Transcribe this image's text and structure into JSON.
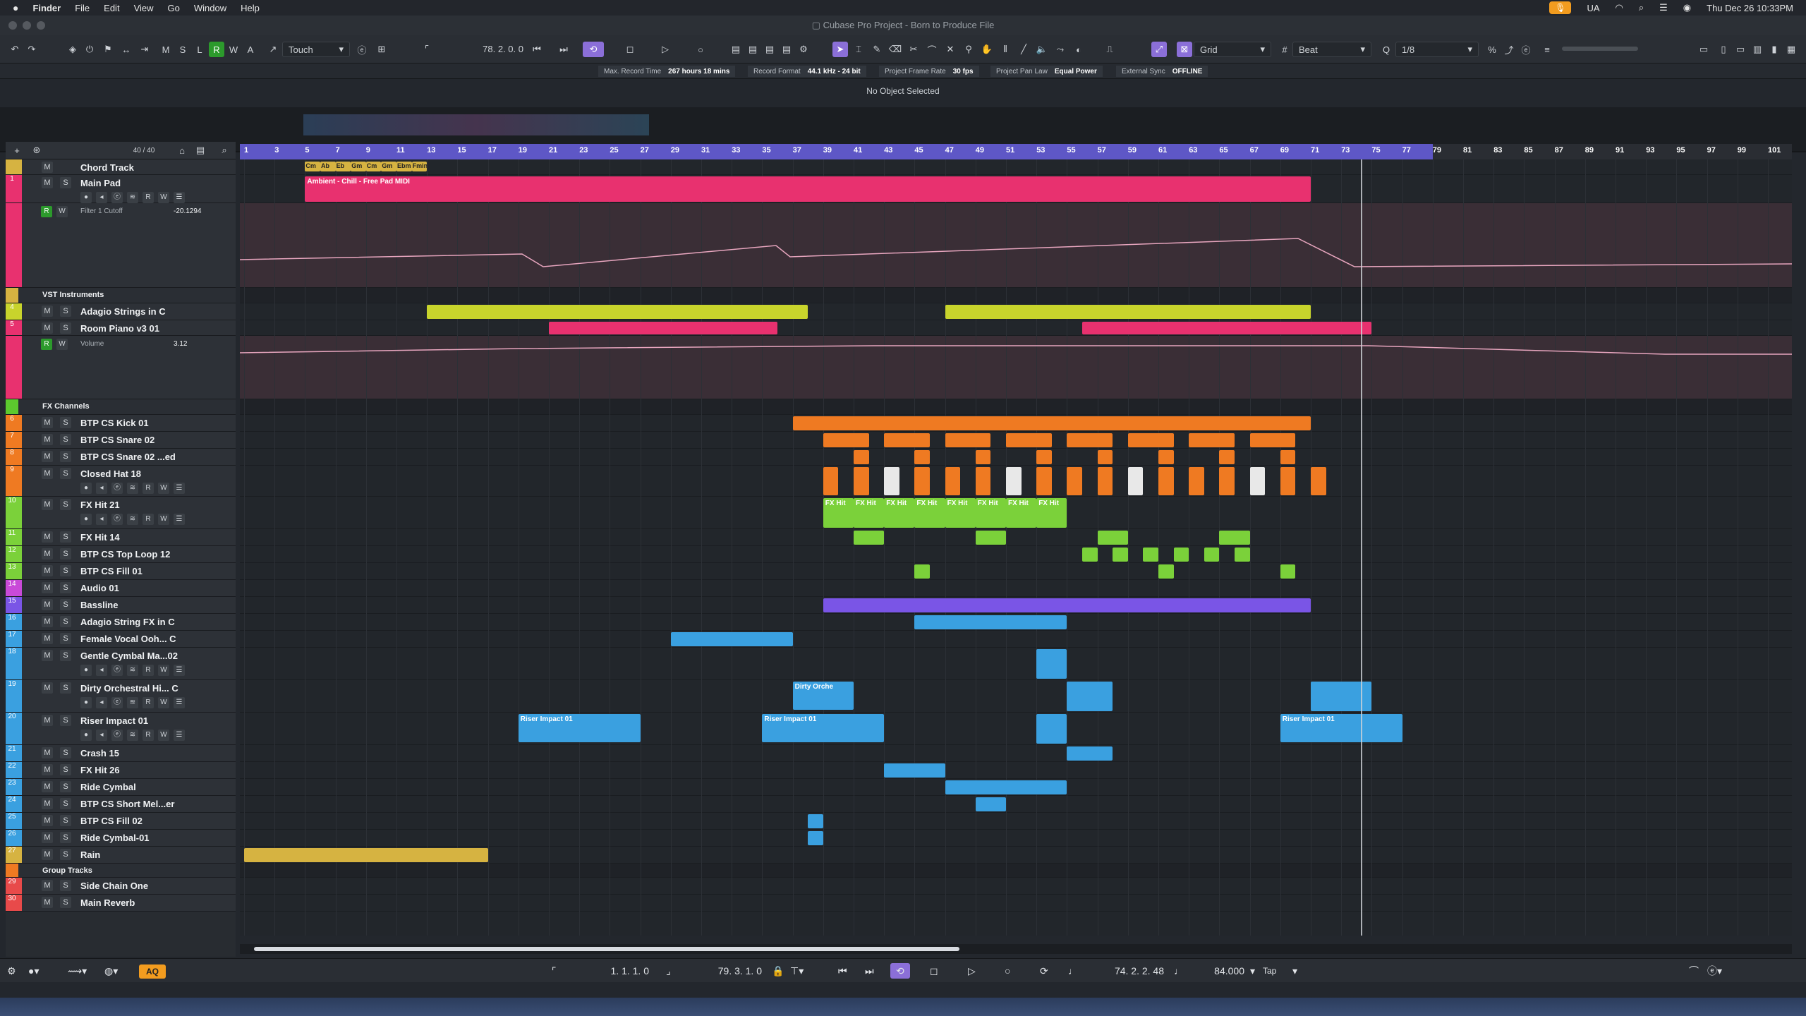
{
  "menubar": {
    "apple": "",
    "app": "Finder",
    "items": [
      "File",
      "Edit",
      "View",
      "Go",
      "Window",
      "Help"
    ],
    "lang": "UA",
    "datetime": "Thu Dec 26  10:33PM"
  },
  "window": {
    "title": "Cubase Pro Project - Born to Produce File"
  },
  "toolbar": {
    "automation_mode": "Touch",
    "position": "78. 2. 0.  0",
    "grid_type": "Grid",
    "grid_unit": "Beat",
    "quantize": "1/8"
  },
  "infoline": {
    "items": [
      {
        "label": "Max. Record Time",
        "value": "267 hours 18 mins"
      },
      {
        "label": "Record Format",
        "value": "44.1 kHz - 24 bit"
      },
      {
        "label": "Project Frame Rate",
        "value": "30 fps"
      },
      {
        "label": "Project Pan Law",
        "value": "Equal Power"
      },
      {
        "label": "External Sync",
        "value": "OFFLINE"
      }
    ]
  },
  "object_status": "No Object Selected",
  "track_header": {
    "count": "40 / 40"
  },
  "ruler": {
    "ticks": [
      "1",
      "3",
      "5",
      "7",
      "9",
      "11",
      "13",
      "15",
      "17",
      "19",
      "21",
      "23",
      "25",
      "27",
      "29",
      "31",
      "33",
      "35",
      "37",
      "39",
      "41",
      "43",
      "45",
      "47",
      "49",
      "51",
      "53",
      "55",
      "57",
      "59",
      "61",
      "63",
      "65",
      "67",
      "69",
      "71",
      "73",
      "75",
      "77",
      "79",
      "81",
      "83",
      "85",
      "87",
      "89",
      "91",
      "93",
      "95",
      "97",
      "99",
      "101"
    ]
  },
  "tracks": [
    {
      "num": "",
      "name": "Chord Track",
      "color": "#d6b341",
      "type": "chord",
      "h": 22
    },
    {
      "num": "1",
      "name": "Main Pad",
      "color": "#e8316f",
      "type": "inst",
      "h": 40
    },
    {
      "num": "",
      "name": "Filter 1 Cutoff",
      "color": "#e8316f",
      "type": "auto",
      "h": 120,
      "value": "-20.1294"
    },
    {
      "num": "",
      "name": "VST Instruments",
      "color": "#d6b341",
      "type": "folder",
      "h": 22
    },
    {
      "num": "4",
      "name": "Adagio Strings in C",
      "color": "#c8d42c",
      "type": "inst",
      "h": 24
    },
    {
      "num": "5",
      "name": "Room Piano v3 01",
      "color": "#e8316f",
      "type": "inst",
      "h": 22
    },
    {
      "num": "",
      "name": "Volume",
      "color": "#e8316f",
      "type": "auto",
      "h": 90,
      "value": "3.12"
    },
    {
      "num": "",
      "name": "FX Channels",
      "color": "#5cc92e",
      "type": "folder",
      "h": 22
    },
    {
      "num": "6",
      "name": "BTP CS Kick 01",
      "color": "#ef7a22",
      "type": "audio",
      "h": 24
    },
    {
      "num": "7",
      "name": "BTP CS Snare 02",
      "color": "#ef7a22",
      "type": "audio",
      "h": 24
    },
    {
      "num": "8",
      "name": "BTP CS Snare 02 ...ed",
      "color": "#ef7a22",
      "type": "audio",
      "h": 24
    },
    {
      "num": "9",
      "name": "Closed Hat 18",
      "color": "#ef7a22",
      "type": "audio",
      "h": 44
    },
    {
      "num": "10",
      "name": "FX Hit 21",
      "color": "#7bd13a",
      "type": "audio",
      "h": 46
    },
    {
      "num": "11",
      "name": "FX Hit 14",
      "color": "#7bd13a",
      "type": "audio",
      "h": 24
    },
    {
      "num": "12",
      "name": "BTP CS Top Loop 12",
      "color": "#7bd13a",
      "type": "audio",
      "h": 24
    },
    {
      "num": "13",
      "name": "BTP CS Fill 01",
      "color": "#7bd13a",
      "type": "audio",
      "h": 24
    },
    {
      "num": "14",
      "name": "Audio 01",
      "color": "#c94ad8",
      "type": "audio",
      "h": 24
    },
    {
      "num": "15",
      "name": "Bassline",
      "color": "#7a55e6",
      "type": "inst",
      "h": 24
    },
    {
      "num": "16",
      "name": "Adagio String FX in C",
      "color": "#3aa0e0",
      "type": "audio",
      "h": 24
    },
    {
      "num": "17",
      "name": "Female Vocal Ooh... C",
      "color": "#3aa0e0",
      "type": "audio",
      "h": 24
    },
    {
      "num": "18",
      "name": "Gentle Cymbal Ma...02",
      "color": "#3aa0e0",
      "type": "audio",
      "h": 46
    },
    {
      "num": "19",
      "name": "Dirty Orchestral Hi... C",
      "color": "#3aa0e0",
      "type": "audio",
      "h": 46
    },
    {
      "num": "20",
      "name": "Riser Impact 01",
      "color": "#3aa0e0",
      "type": "audio",
      "h": 46
    },
    {
      "num": "21",
      "name": "Crash 15",
      "color": "#3aa0e0",
      "type": "audio",
      "h": 24
    },
    {
      "num": "22",
      "name": "FX Hit 26",
      "color": "#3aa0e0",
      "type": "audio",
      "h": 24
    },
    {
      "num": "23",
      "name": "Ride Cymbal",
      "color": "#3aa0e0",
      "type": "audio",
      "h": 24
    },
    {
      "num": "24",
      "name": "BTP CS Short Mel...er",
      "color": "#3aa0e0",
      "type": "audio",
      "h": 24
    },
    {
      "num": "25",
      "name": "BTP CS Fill 02",
      "color": "#3aa0e0",
      "type": "audio",
      "h": 24
    },
    {
      "num": "26",
      "name": "Ride Cymbal-01",
      "color": "#3aa0e0",
      "type": "audio",
      "h": 24
    },
    {
      "num": "27",
      "name": "Rain",
      "color": "#d6b341",
      "type": "audio",
      "h": 24
    },
    {
      "num": "",
      "name": "Group Tracks",
      "color": "#ef7a22",
      "type": "folder",
      "h": 20
    },
    {
      "num": "29",
      "name": "Side Chain One",
      "color": "#e84a4a",
      "type": "group",
      "h": 24
    },
    {
      "num": "30",
      "name": "Main Reverb",
      "color": "#e84a4a",
      "type": "fx",
      "h": 24
    }
  ],
  "clips": {
    "chord_labels": [
      "Cm",
      "Ab",
      "Eb",
      "Gm",
      "Cm",
      "Gm",
      "Ebm",
      "Fmin"
    ],
    "main_pad": "Ambient - Chill - Free Pad MIDI",
    "fx_hit": "FX Hit",
    "dirty_orch": "Dirty Orche",
    "riser": "Riser Impact 01"
  },
  "transport": {
    "left_locator": "1. 1. 1.  0",
    "right_locator": "79. 3. 1.  0",
    "aq": "AQ",
    "position": "74. 2. 2. 48",
    "tempo": "84.000",
    "tap": "Tap"
  }
}
